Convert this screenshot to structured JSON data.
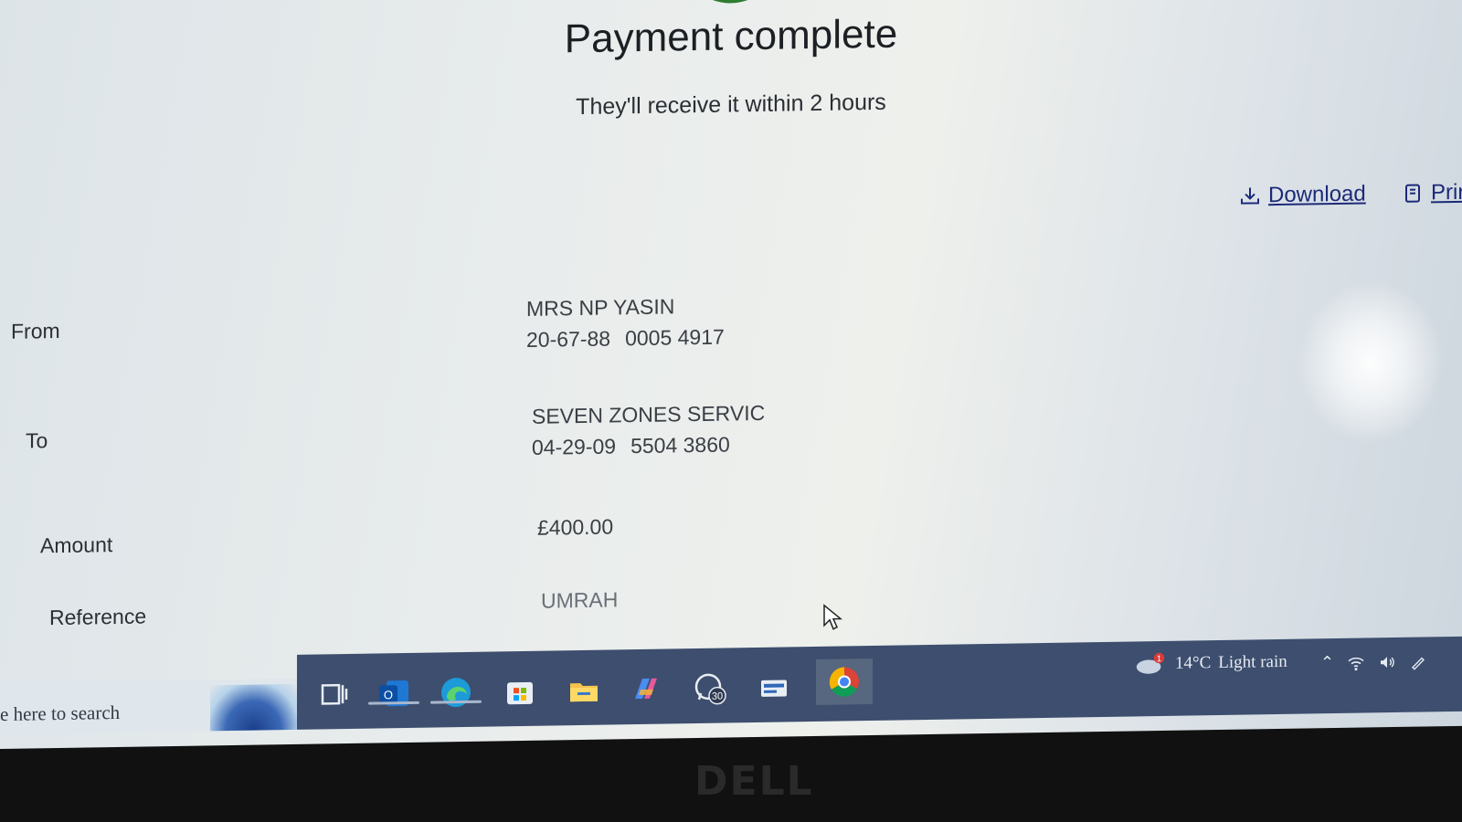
{
  "confirmation": {
    "title": "Payment complete",
    "subtitle": "They'll receive it within 2 hours"
  },
  "actions": {
    "download_label": "Download",
    "print_label": "Prir"
  },
  "details": {
    "from": {
      "label": "From",
      "name": "MRS NP YASIN",
      "sort_code": "20-67-88",
      "account_number": "0005 4917"
    },
    "to": {
      "label": "To",
      "name": "SEVEN ZONES SERVIC",
      "sort_code": "04-29-09",
      "account_number": "5504 3860"
    },
    "amount": {
      "label": "Amount",
      "value": "£400.00"
    },
    "reference": {
      "label": "Reference",
      "value": "UMRAH"
    }
  },
  "taskbar": {
    "search_placeholder": "e here to search",
    "whatsapp_badge": "30",
    "weather": {
      "temperature": "14°C",
      "condition": "Light rain",
      "alert_badge": "1"
    },
    "apps": [
      "task-view",
      "outlook",
      "edge",
      "microsoft-store",
      "file-explorer",
      "copilot",
      "whatsapp",
      "app",
      "chrome"
    ]
  },
  "bezel": {
    "brand": "DELL"
  }
}
